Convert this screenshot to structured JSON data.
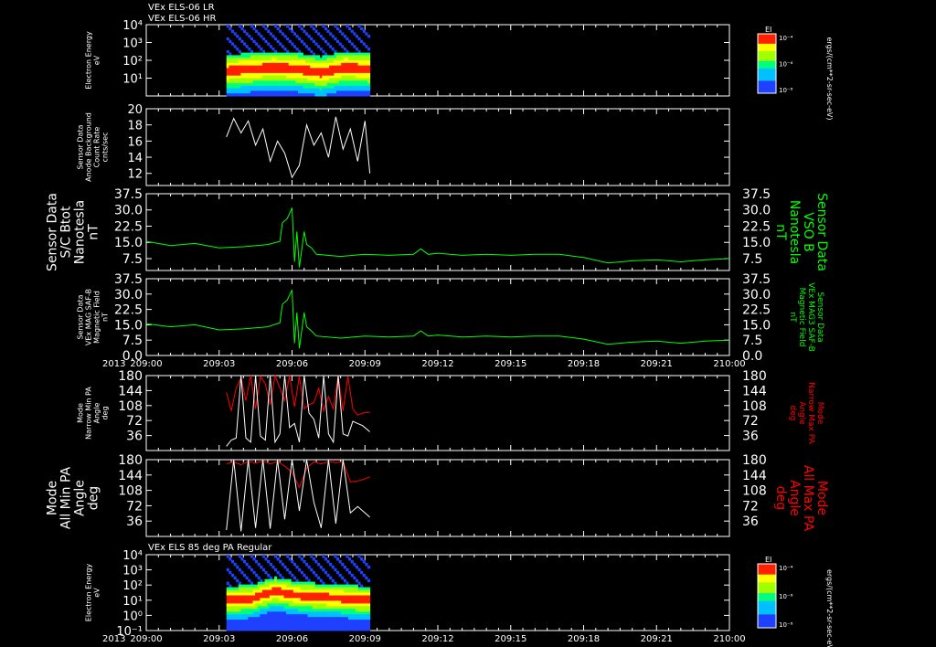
{
  "header": {
    "line1": "VEx ELS-06 LR",
    "line2": "VEx ELS-06 HR",
    "panel7_title": "VEx ELS 85 deg PA Regular"
  },
  "colors": {
    "background": "#000000",
    "axis": "#ffffff",
    "mag": "#00ff00",
    "maxpa": "#ff0000",
    "minpa": "#ffffff"
  },
  "time_axis": {
    "year_label": "2013",
    "ticks": [
      "209:00",
      "209:03",
      "209:06",
      "209:09",
      "209:12",
      "209:15",
      "209:18",
      "209:21",
      "210:00"
    ]
  },
  "chart_data": [
    {
      "type": "heatmap",
      "panel": "electron-energy-lr-hr",
      "ylabel": [
        "Electron Energy",
        "eV"
      ],
      "yscale": "log",
      "ylim": [
        1,
        10000
      ],
      "yticks": [
        "10⁴",
        "10³",
        "10²",
        "10¹"
      ],
      "colorbar": {
        "title": "EI",
        "ticks": [
          "10⁻⁴",
          "10⁻⁶",
          "10⁻⁸"
        ],
        "unit_label": "ergs/(cm**2-sr-sec-eV)"
      },
      "x_range_hours": [
        0.25,
        0.15
      ],
      "x": [
        3.3,
        9.2
      ],
      "band_center_log": [
        1.4,
        1.5,
        1.6,
        1.5,
        1.3,
        1.6,
        1.5
      ]
    },
    {
      "type": "line",
      "panel": "anode-background",
      "ylabel": [
        "Sensor Data",
        "Anode Background",
        "Count Rate",
        "cnts/sec"
      ],
      "ylim": [
        10.5,
        20
      ],
      "yticks": [
        "20",
        "18",
        "16",
        "14",
        "12"
      ],
      "series": [
        {
          "x": [
            3.3,
            3.6,
            3.9,
            4.2,
            4.5,
            4.8,
            5.1,
            5.4,
            5.7,
            6.0,
            6.3,
            6.6,
            6.9,
            7.2,
            7.5,
            7.8,
            8.1,
            8.4,
            8.7,
            9.0,
            9.2
          ],
          "values": [
            16.5,
            18.8,
            17.0,
            18.5,
            15.5,
            17.5,
            13.5,
            16.0,
            14.5,
            11.5,
            13.0,
            18.0,
            15.5,
            17.0,
            14.0,
            19.0,
            15.0,
            17.5,
            13.5,
            18.5,
            12.0
          ]
        }
      ]
    },
    {
      "type": "line",
      "panel": "sc-btot",
      "ylabel": [
        "Sensor Data",
        "S/C Btot",
        "Nanotesla",
        "nT"
      ],
      "ylabel_right": [
        "Sensor Data",
        "VSO B",
        "Nanotesla",
        "nT"
      ],
      "ylim": [
        2,
        37.5
      ],
      "yticks": [
        "37.5",
        "30.0",
        "22.5",
        "15.0",
        "7.5"
      ],
      "series": [
        {
          "name": "Btot",
          "x": [
            0,
            1,
            2,
            3,
            4,
            5,
            5.5,
            5.6,
            5.8,
            6.0,
            6.1,
            6.2,
            6.3,
            6.5,
            6.6,
            6.8,
            7.0,
            8,
            9,
            10,
            11,
            11.3,
            11.6,
            12,
            13,
            14,
            15,
            16,
            17,
            18,
            19,
            20,
            21,
            22,
            23,
            24
          ],
          "values": [
            15.5,
            13.5,
            14.5,
            12.5,
            13.0,
            14.0,
            15.5,
            24.0,
            26.0,
            31.0,
            6.0,
            20.0,
            3.5,
            20.0,
            14.0,
            12.5,
            9.5,
            8.5,
            9.5,
            9.0,
            9.5,
            12.0,
            9.5,
            10.0,
            9.0,
            9.5,
            9.0,
            9.5,
            9.5,
            8.0,
            5.5,
            6.5,
            7.0,
            6.0,
            7.0,
            7.5
          ]
        }
      ]
    },
    {
      "type": "line",
      "panel": "mag-saf-b",
      "ylabel": [
        "Sensor Data",
        "VEx MAG SAF-B",
        "Magnetic Field",
        "nT"
      ],
      "ylabel_right": [
        "Sensor Data",
        "VEx MAG3 SAF-B",
        "Magnetic Field",
        "nT"
      ],
      "ylim": [
        0,
        37.5
      ],
      "yticks": [
        "37.5",
        "30.0",
        "22.5",
        "15.0",
        "7.5",
        "0.0"
      ],
      "series": [
        {
          "name": "B",
          "x": [
            0,
            1,
            2,
            3,
            4,
            5,
            5.5,
            5.6,
            5.8,
            6.0,
            6.1,
            6.2,
            6.3,
            6.5,
            6.6,
            6.8,
            7.0,
            8,
            9,
            10,
            11,
            11.3,
            11.6,
            12,
            13,
            14,
            15,
            16,
            17,
            18,
            19,
            20,
            21,
            22,
            23,
            24
          ],
          "values": [
            15.5,
            14.0,
            15.0,
            12.5,
            13.0,
            14.0,
            16.0,
            25.0,
            27.0,
            32.0,
            6.0,
            21.0,
            3.5,
            21.0,
            14.0,
            12.0,
            9.5,
            8.5,
            9.5,
            9.0,
            9.5,
            12.0,
            9.5,
            10.0,
            9.0,
            9.5,
            9.0,
            9.5,
            9.5,
            8.0,
            5.5,
            6.5,
            7.0,
            6.0,
            7.0,
            7.5
          ]
        }
      ]
    },
    {
      "type": "line",
      "panel": "narrow-pa",
      "ylabel": [
        "Mode",
        "Narrow Min PA",
        "Angle",
        "deg"
      ],
      "ylabel_right": [
        "Mode",
        "Narrow Max PA",
        "Angle",
        "deg"
      ],
      "ylim": [
        0,
        180
      ],
      "yticks": [
        "180",
        "144",
        "108",
        "72",
        "36"
      ],
      "series": [
        {
          "name": "Max PA",
          "x": [
            3.3,
            3.5,
            3.7,
            3.9,
            4.1,
            4.3,
            4.5,
            4.7,
            4.9,
            5.1,
            5.3,
            5.5,
            5.7,
            5.9,
            6.1,
            6.3,
            6.5,
            6.7,
            6.9,
            7.1,
            7.3,
            7.5,
            7.7,
            7.9,
            8.1,
            8.3,
            8.5,
            8.7,
            8.9,
            9.2
          ],
          "values": [
            140,
            95,
            150,
            175,
            120,
            180,
            100,
            178,
            160,
            110,
            180,
            150,
            120,
            180,
            105,
            178,
            100,
            110,
            115,
            150,
            95,
            130,
            100,
            180,
            95,
            178,
            100,
            85,
            90,
            92
          ]
        },
        {
          "name": "Min PA",
          "x": [
            3.3,
            3.5,
            3.7,
            3.9,
            4.1,
            4.3,
            4.5,
            4.7,
            4.9,
            5.1,
            5.3,
            5.5,
            5.7,
            5.9,
            6.1,
            6.3,
            6.5,
            6.7,
            6.9,
            7.1,
            7.3,
            7.5,
            7.7,
            7.9,
            8.1,
            8.3,
            8.5,
            8.7,
            8.9,
            9.2
          ],
          "values": [
            10,
            25,
            30,
            180,
            30,
            20,
            180,
            35,
            25,
            180,
            20,
            40,
            180,
            55,
            65,
            20,
            180,
            90,
            75,
            30,
            180,
            40,
            20,
            180,
            40,
            35,
            70,
            65,
            60,
            45
          ]
        }
      ]
    },
    {
      "type": "line",
      "panel": "all-pa",
      "ylabel": [
        "Mode",
        "All Min PA",
        "Angle",
        "deg"
      ],
      "ylabel_right": [
        "Mode",
        "All Max PA",
        "Angle",
        "deg"
      ],
      "ylim": [
        0,
        180
      ],
      "yticks": [
        "180",
        "144",
        "108",
        "72",
        "36"
      ],
      "series": [
        {
          "name": "Max PA",
          "x": [
            3.3,
            3.6,
            3.9,
            4.2,
            4.5,
            4.8,
            5.1,
            5.4,
            5.7,
            6.0,
            6.3,
            6.6,
            6.9,
            7.2,
            7.5,
            7.8,
            8.1,
            8.4,
            8.7,
            9.0,
            9.2
          ],
          "values": [
            170,
            175,
            168,
            176,
            172,
            177,
            170,
            176,
            165,
            150,
            115,
            160,
            175,
            170,
            176,
            173,
            175,
            128,
            130,
            135,
            140
          ]
        },
        {
          "name": "Min PA",
          "x": [
            3.3,
            3.6,
            3.9,
            4.2,
            4.5,
            4.8,
            5.1,
            5.4,
            5.7,
            6.0,
            6.3,
            6.6,
            6.9,
            7.2,
            7.5,
            7.8,
            8.1,
            8.4,
            8.7,
            9.0,
            9.2
          ],
          "values": [
            15,
            180,
            12,
            180,
            20,
            180,
            18,
            180,
            40,
            180,
            60,
            180,
            80,
            20,
            180,
            30,
            180,
            55,
            70,
            55,
            45
          ]
        }
      ]
    },
    {
      "type": "heatmap",
      "panel": "electron-energy-85deg",
      "ylabel": [
        "Electron Energy",
        "eV"
      ],
      "yscale": "log",
      "ylim": [
        0.1,
        10000
      ],
      "yticks": [
        "10⁴",
        "10³",
        "10²",
        "10¹",
        "10⁰",
        "10⁻¹"
      ],
      "colorbar": {
        "title": "EI",
        "ticks": [
          "10⁻⁴",
          "10⁻⁶",
          "10⁻⁸"
        ],
        "unit_label": "ergs/(cm**2-sr-sec-eV)"
      },
      "x": [
        3.3,
        9.2
      ],
      "band_center_log": [
        1.0,
        1.1,
        1.6,
        1.3,
        1.2,
        1.1,
        1.0
      ]
    }
  ]
}
